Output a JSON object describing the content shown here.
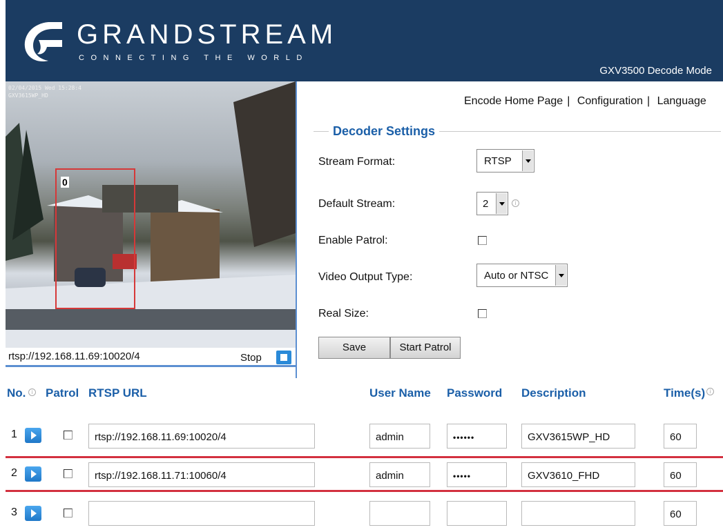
{
  "header": {
    "brand": "GRANDSTREAM",
    "tagline": "CONNECTING THE WORLD",
    "mode": "GXV3500 Decode Mode"
  },
  "video": {
    "osd_line1": "02/04/2015 Wed 15:28:4",
    "osd_line2": "GXV3615WP_HD",
    "motion_label": "0",
    "url": "rtsp://192.168.11.69:10020/4",
    "stop_label": "Stop"
  },
  "nav": {
    "encode_home": "Encode Home Page",
    "sep1": "|",
    "configuration": "Configuration",
    "sep2": "|",
    "language": "Language"
  },
  "settings": {
    "legend": "Decoder Settings",
    "stream_format_label": "Stream Format:",
    "stream_format_value": "RTSP",
    "default_stream_label": "Default Stream:",
    "default_stream_value": "2",
    "enable_patrol_label": "Enable Patrol:",
    "video_output_label": "Video Output Type:",
    "video_output_value": "Auto or NTSC",
    "real_size_label": "Real Size:",
    "save_label": "Save",
    "start_patrol_label": "Start Patrol"
  },
  "table": {
    "headers": {
      "no": "No.",
      "patrol": "Patrol",
      "rtsp_url": "RTSP URL",
      "user_name": "User Name",
      "password": "Password",
      "description": "Description",
      "time": "Time(s)"
    },
    "rows": [
      {
        "no": "1",
        "url": "rtsp://192.168.11.69:10020/4",
        "user": "admin",
        "password": "••••••",
        "description": "GXV3615WP_HD",
        "time": "60"
      },
      {
        "no": "2",
        "url": "rtsp://192.168.11.71:10060/4",
        "user": "admin",
        "password": "•••••",
        "description": "GXV3610_FHD",
        "time": "60"
      },
      {
        "no": "3",
        "url": "",
        "user": "",
        "password": "",
        "description": "",
        "time": "60"
      }
    ]
  },
  "colors": {
    "header_bg": "#1b3c62",
    "accent_blue": "#1b5fa8",
    "highlight_red": "#d3303f"
  }
}
